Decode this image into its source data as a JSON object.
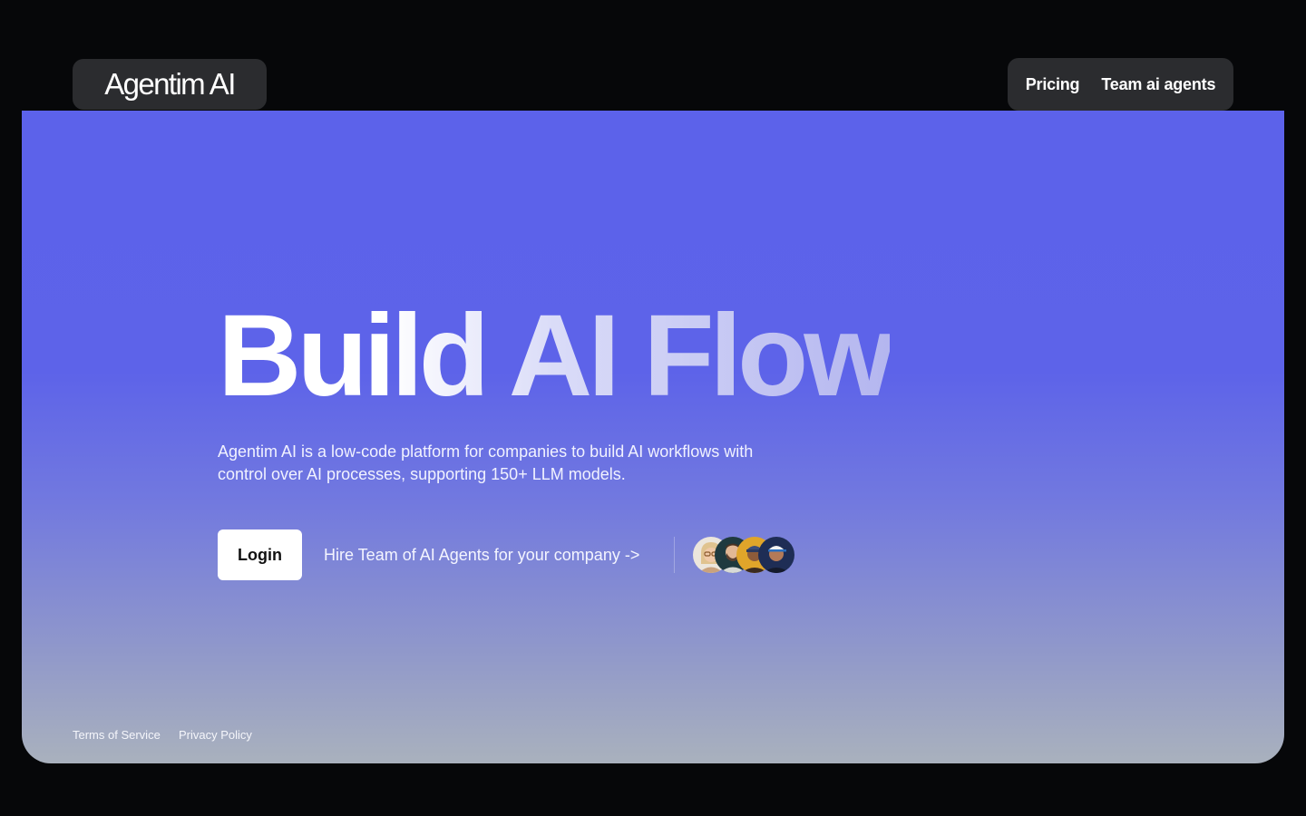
{
  "brand": {
    "logo_text": "Agentim AI"
  },
  "nav": {
    "items": [
      {
        "label": "Pricing"
      },
      {
        "label": "Team ai agents"
      }
    ]
  },
  "hero": {
    "headline": "Build AI Flow",
    "description": "Agentim AI is a low-code platform for companies to build AI workflows with control over AI processes, supporting 150+ LLM models.",
    "login_label": "Login",
    "hire_link": "Hire Team of AI Agents for your company ->",
    "avatars": [
      {
        "icon": "avatar-woman-glasses-icon"
      },
      {
        "icon": "avatar-man-beard-icon"
      },
      {
        "icon": "avatar-man-cap-icon"
      },
      {
        "icon": "avatar-man-headset-icon"
      }
    ]
  },
  "footer": {
    "terms": "Terms of Service",
    "privacy": "Privacy Policy"
  },
  "colors": {
    "background": "#060709",
    "hero_top": "#5c62ea",
    "hero_bottom": "#a9b1bd",
    "pill_bg": "#2b2c2f",
    "button_bg": "#ffffff"
  }
}
